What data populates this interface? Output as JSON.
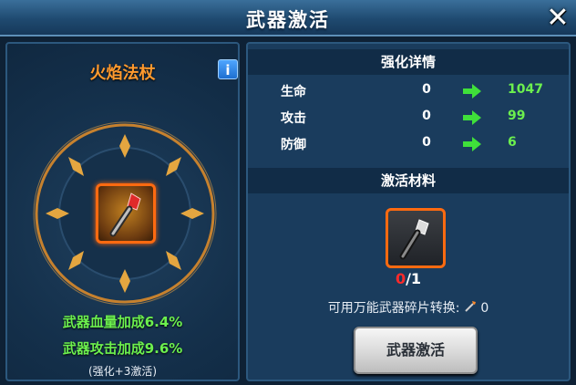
{
  "header": {
    "title": "武器激活",
    "close_icon": "close-icon"
  },
  "weapon": {
    "name": "火焰法杖",
    "info_label": "i"
  },
  "bonuses": {
    "hp_bonus": "武器血量加成6.4%",
    "attack_bonus": "武器攻击加成9.6%",
    "note": "(强化+3激活)"
  },
  "enhance": {
    "title": "强化详情",
    "stats": [
      {
        "label": "生命",
        "old": "0",
        "new": "1047"
      },
      {
        "label": "攻击",
        "old": "0",
        "new": "99"
      },
      {
        "label": "防御",
        "old": "0",
        "new": "6"
      }
    ]
  },
  "materials": {
    "title": "激活材料",
    "have": "0",
    "need": "/1",
    "convert_label": "可用万能武器碎片转换:",
    "convert_count": "0"
  },
  "activate_button": "武器激活",
  "colors": {
    "accent_orange": "#ff9a2e",
    "bonus_green": "#6cf04e",
    "count_red": "#ff2a2a"
  }
}
